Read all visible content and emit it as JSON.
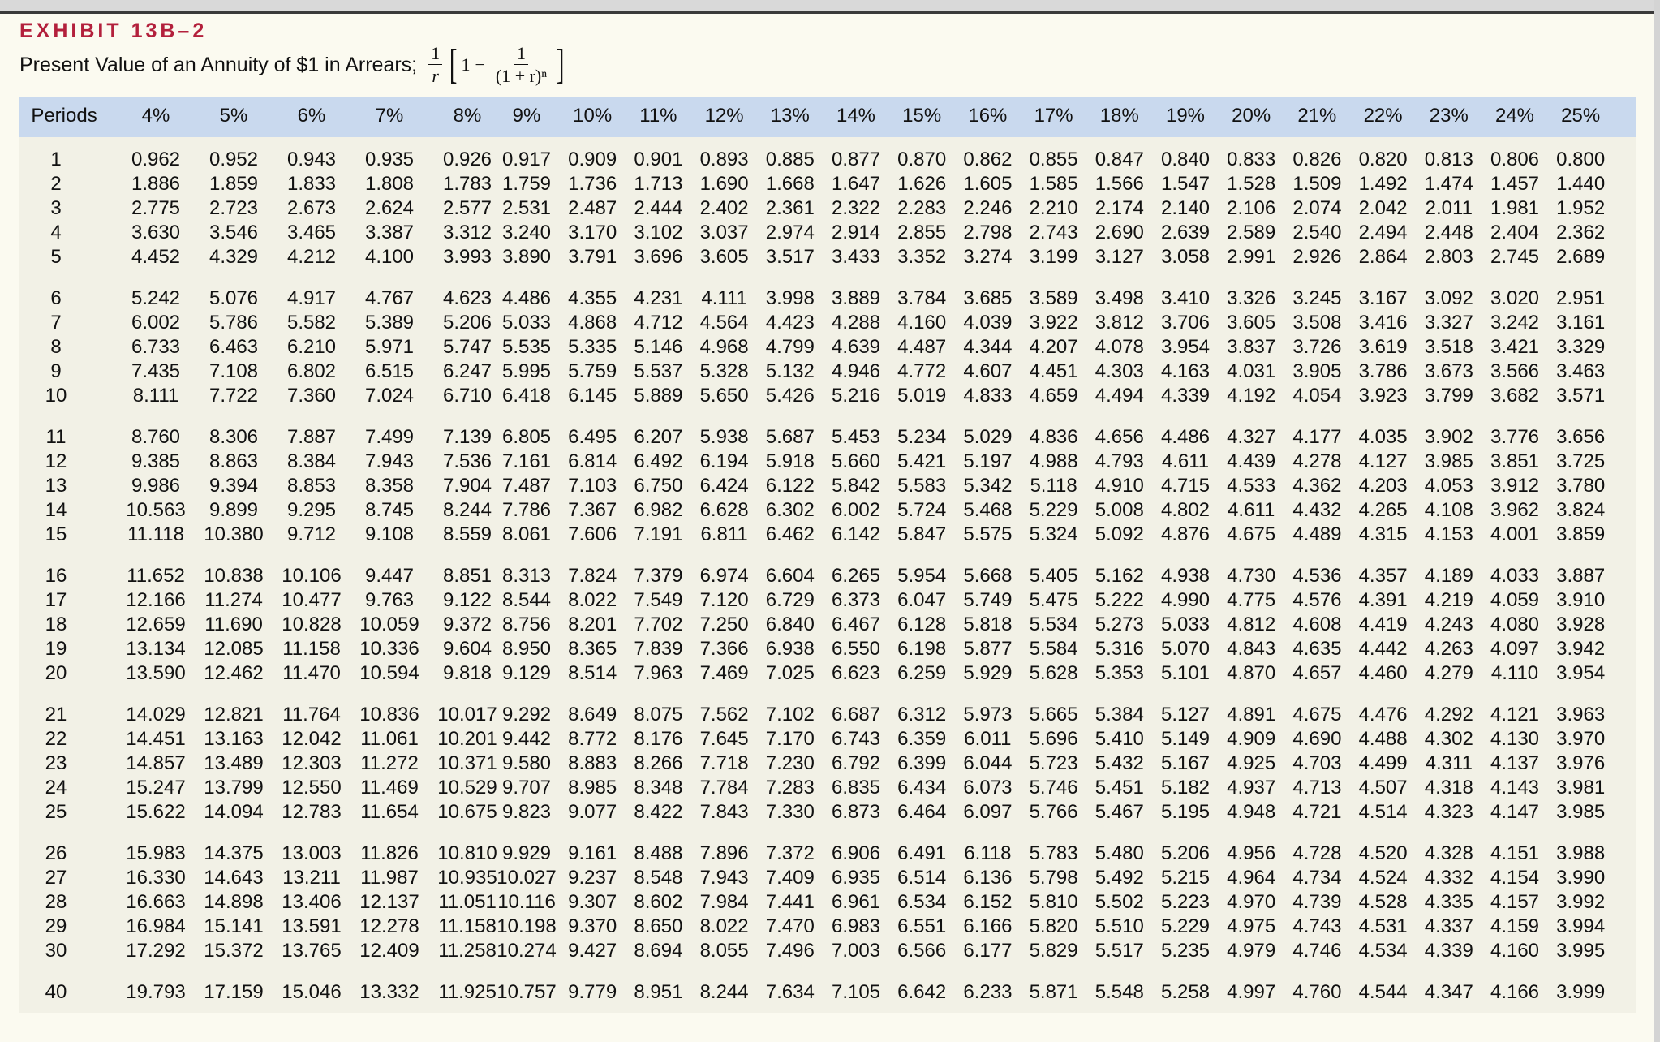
{
  "exhibit": {
    "label": "EXHIBIT 13B–2",
    "title": "Present Value of an Annuity of $1 in Arrears;",
    "formula": {
      "a_num": "1",
      "a_den": "r",
      "one": "1",
      "minus": "−",
      "b_num": "1",
      "b_den": "(1 + r)ⁿ"
    }
  },
  "table": {
    "period_header": "Periods",
    "rates": [
      "4%",
      "5%",
      "6%",
      "7%",
      "8%",
      "9%",
      "10%",
      "11%",
      "12%",
      "13%",
      "14%",
      "15%",
      "16%",
      "17%",
      "18%",
      "19%",
      "20%",
      "21%",
      "22%",
      "23%",
      "24%",
      "25%"
    ],
    "groups": [
      [
        {
          "period": "1",
          "values": [
            "0.962",
            "0.952",
            "0.943",
            "0.935",
            "0.926",
            "0.917",
            "0.909",
            "0.901",
            "0.893",
            "0.885",
            "0.877",
            "0.870",
            "0.862",
            "0.855",
            "0.847",
            "0.840",
            "0.833",
            "0.826",
            "0.820",
            "0.813",
            "0.806",
            "0.800"
          ]
        },
        {
          "period": "2",
          "values": [
            "1.886",
            "1.859",
            "1.833",
            "1.808",
            "1.783",
            "1.759",
            "1.736",
            "1.713",
            "1.690",
            "1.668",
            "1.647",
            "1.626",
            "1.605",
            "1.585",
            "1.566",
            "1.547",
            "1.528",
            "1.509",
            "1.492",
            "1.474",
            "1.457",
            "1.440"
          ]
        },
        {
          "period": "3",
          "values": [
            "2.775",
            "2.723",
            "2.673",
            "2.624",
            "2.577",
            "2.531",
            "2.487",
            "2.444",
            "2.402",
            "2.361",
            "2.322",
            "2.283",
            "2.246",
            "2.210",
            "2.174",
            "2.140",
            "2.106",
            "2.074",
            "2.042",
            "2.011",
            "1.981",
            "1.952"
          ]
        },
        {
          "period": "4",
          "values": [
            "3.630",
            "3.546",
            "3.465",
            "3.387",
            "3.312",
            "3.240",
            "3.170",
            "3.102",
            "3.037",
            "2.974",
            "2.914",
            "2.855",
            "2.798",
            "2.743",
            "2.690",
            "2.639",
            "2.589",
            "2.540",
            "2.494",
            "2.448",
            "2.404",
            "2.362"
          ]
        },
        {
          "period": "5",
          "values": [
            "4.452",
            "4.329",
            "4.212",
            "4.100",
            "3.993",
            "3.890",
            "3.791",
            "3.696",
            "3.605",
            "3.517",
            "3.433",
            "3.352",
            "3.274",
            "3.199",
            "3.127",
            "3.058",
            "2.991",
            "2.926",
            "2.864",
            "2.803",
            "2.745",
            "2.689"
          ]
        }
      ],
      [
        {
          "period": "6",
          "values": [
            "5.242",
            "5.076",
            "4.917",
            "4.767",
            "4.623",
            "4.486",
            "4.355",
            "4.231",
            "4.111",
            "3.998",
            "3.889",
            "3.784",
            "3.685",
            "3.589",
            "3.498",
            "3.410",
            "3.326",
            "3.245",
            "3.167",
            "3.092",
            "3.020",
            "2.951"
          ]
        },
        {
          "period": "7",
          "values": [
            "6.002",
            "5.786",
            "5.582",
            "5.389",
            "5.206",
            "5.033",
            "4.868",
            "4.712",
            "4.564",
            "4.423",
            "4.288",
            "4.160",
            "4.039",
            "3.922",
            "3.812",
            "3.706",
            "3.605",
            "3.508",
            "3.416",
            "3.327",
            "3.242",
            "3.161"
          ]
        },
        {
          "period": "8",
          "values": [
            "6.733",
            "6.463",
            "6.210",
            "5.971",
            "5.747",
            "5.535",
            "5.335",
            "5.146",
            "4.968",
            "4.799",
            "4.639",
            "4.487",
            "4.344",
            "4.207",
            "4.078",
            "3.954",
            "3.837",
            "3.726",
            "3.619",
            "3.518",
            "3.421",
            "3.329"
          ]
        },
        {
          "period": "9",
          "values": [
            "7.435",
            "7.108",
            "6.802",
            "6.515",
            "6.247",
            "5.995",
            "5.759",
            "5.537",
            "5.328",
            "5.132",
            "4.946",
            "4.772",
            "4.607",
            "4.451",
            "4.303",
            "4.163",
            "4.031",
            "3.905",
            "3.786",
            "3.673",
            "3.566",
            "3.463"
          ]
        },
        {
          "period": "10",
          "values": [
            "8.111",
            "7.722",
            "7.360",
            "7.024",
            "6.710",
            "6.418",
            "6.145",
            "5.889",
            "5.650",
            "5.426",
            "5.216",
            "5.019",
            "4.833",
            "4.659",
            "4.494",
            "4.339",
            "4.192",
            "4.054",
            "3.923",
            "3.799",
            "3.682",
            "3.571"
          ]
        }
      ],
      [
        {
          "period": "11",
          "values": [
            "8.760",
            "8.306",
            "7.887",
            "7.499",
            "7.139",
            "6.805",
            "6.495",
            "6.207",
            "5.938",
            "5.687",
            "5.453",
            "5.234",
            "5.029",
            "4.836",
            "4.656",
            "4.486",
            "4.327",
            "4.177",
            "4.035",
            "3.902",
            "3.776",
            "3.656"
          ]
        },
        {
          "period": "12",
          "values": [
            "9.385",
            "8.863",
            "8.384",
            "7.943",
            "7.536",
            "7.161",
            "6.814",
            "6.492",
            "6.194",
            "5.918",
            "5.660",
            "5.421",
            "5.197",
            "4.988",
            "4.793",
            "4.611",
            "4.439",
            "4.278",
            "4.127",
            "3.985",
            "3.851",
            "3.725"
          ]
        },
        {
          "period": "13",
          "values": [
            "9.986",
            "9.394",
            "8.853",
            "8.358",
            "7.904",
            "7.487",
            "7.103",
            "6.750",
            "6.424",
            "6.122",
            "5.842",
            "5.583",
            "5.342",
            "5.118",
            "4.910",
            "4.715",
            "4.533",
            "4.362",
            "4.203",
            "4.053",
            "3.912",
            "3.780"
          ]
        },
        {
          "period": "14",
          "values": [
            "10.563",
            "9.899",
            "9.295",
            "8.745",
            "8.244",
            "7.786",
            "7.367",
            "6.982",
            "6.628",
            "6.302",
            "6.002",
            "5.724",
            "5.468",
            "5.229",
            "5.008",
            "4.802",
            "4.611",
            "4.432",
            "4.265",
            "4.108",
            "3.962",
            "3.824"
          ]
        },
        {
          "period": "15",
          "values": [
            "11.118",
            "10.380",
            "9.712",
            "9.108",
            "8.559",
            "8.061",
            "7.606",
            "7.191",
            "6.811",
            "6.462",
            "6.142",
            "5.847",
            "5.575",
            "5.324",
            "5.092",
            "4.876",
            "4.675",
            "4.489",
            "4.315",
            "4.153",
            "4.001",
            "3.859"
          ]
        }
      ],
      [
        {
          "period": "16",
          "values": [
            "11.652",
            "10.838",
            "10.106",
            "9.447",
            "8.851",
            "8.313",
            "7.824",
            "7.379",
            "6.974",
            "6.604",
            "6.265",
            "5.954",
            "5.668",
            "5.405",
            "5.162",
            "4.938",
            "4.730",
            "4.536",
            "4.357",
            "4.189",
            "4.033",
            "3.887"
          ]
        },
        {
          "period": "17",
          "values": [
            "12.166",
            "11.274",
            "10.477",
            "9.763",
            "9.122",
            "8.544",
            "8.022",
            "7.549",
            "7.120",
            "6.729",
            "6.373",
            "6.047",
            "5.749",
            "5.475",
            "5.222",
            "4.990",
            "4.775",
            "4.576",
            "4.391",
            "4.219",
            "4.059",
            "3.910"
          ]
        },
        {
          "period": "18",
          "values": [
            "12.659",
            "11.690",
            "10.828",
            "10.059",
            "9.372",
            "8.756",
            "8.201",
            "7.702",
            "7.250",
            "6.840",
            "6.467",
            "6.128",
            "5.818",
            "5.534",
            "5.273",
            "5.033",
            "4.812",
            "4.608",
            "4.419",
            "4.243",
            "4.080",
            "3.928"
          ]
        },
        {
          "period": "19",
          "values": [
            "13.134",
            "12.085",
            "11.158",
            "10.336",
            "9.604",
            "8.950",
            "8.365",
            "7.839",
            "7.366",
            "6.938",
            "6.550",
            "6.198",
            "5.877",
            "5.584",
            "5.316",
            "5.070",
            "4.843",
            "4.635",
            "4.442",
            "4.263",
            "4.097",
            "3.942"
          ]
        },
        {
          "period": "20",
          "values": [
            "13.590",
            "12.462",
            "11.470",
            "10.594",
            "9.818",
            "9.129",
            "8.514",
            "7.963",
            "7.469",
            "7.025",
            "6.623",
            "6.259",
            "5.929",
            "5.628",
            "5.353",
            "5.101",
            "4.870",
            "4.657",
            "4.460",
            "4.279",
            "4.110",
            "3.954"
          ]
        }
      ],
      [
        {
          "period": "21",
          "values": [
            "14.029",
            "12.821",
            "11.764",
            "10.836",
            "10.017",
            "9.292",
            "8.649",
            "8.075",
            "7.562",
            "7.102",
            "6.687",
            "6.312",
            "5.973",
            "5.665",
            "5.384",
            "5.127",
            "4.891",
            "4.675",
            "4.476",
            "4.292",
            "4.121",
            "3.963"
          ]
        },
        {
          "period": "22",
          "values": [
            "14.451",
            "13.163",
            "12.042",
            "11.061",
            "10.201",
            "9.442",
            "8.772",
            "8.176",
            "7.645",
            "7.170",
            "6.743",
            "6.359",
            "6.011",
            "5.696",
            "5.410",
            "5.149",
            "4.909",
            "4.690",
            "4.488",
            "4.302",
            "4.130",
            "3.970"
          ]
        },
        {
          "period": "23",
          "values": [
            "14.857",
            "13.489",
            "12.303",
            "11.272",
            "10.371",
            "9.580",
            "8.883",
            "8.266",
            "7.718",
            "7.230",
            "6.792",
            "6.399",
            "6.044",
            "5.723",
            "5.432",
            "5.167",
            "4.925",
            "4.703",
            "4.499",
            "4.311",
            "4.137",
            "3.976"
          ]
        },
        {
          "period": "24",
          "values": [
            "15.247",
            "13.799",
            "12.550",
            "11.469",
            "10.529",
            "9.707",
            "8.985",
            "8.348",
            "7.784",
            "7.283",
            "6.835",
            "6.434",
            "6.073",
            "5.746",
            "5.451",
            "5.182",
            "4.937",
            "4.713",
            "4.507",
            "4.318",
            "4.143",
            "3.981"
          ]
        },
        {
          "period": "25",
          "values": [
            "15.622",
            "14.094",
            "12.783",
            "11.654",
            "10.675",
            "9.823",
            "9.077",
            "8.422",
            "7.843",
            "7.330",
            "6.873",
            "6.464",
            "6.097",
            "5.766",
            "5.467",
            "5.195",
            "4.948",
            "4.721",
            "4.514",
            "4.323",
            "4.147",
            "3.985"
          ]
        }
      ],
      [
        {
          "period": "26",
          "values": [
            "15.983",
            "14.375",
            "13.003",
            "11.826",
            "10.810",
            "9.929",
            "9.161",
            "8.488",
            "7.896",
            "7.372",
            "6.906",
            "6.491",
            "6.118",
            "5.783",
            "5.480",
            "5.206",
            "4.956",
            "4.728",
            "4.520",
            "4.328",
            "4.151",
            "3.988"
          ]
        },
        {
          "period": "27",
          "values": [
            "16.330",
            "14.643",
            "13.211",
            "11.987",
            "10.935",
            "10.027",
            "9.237",
            "8.548",
            "7.943",
            "7.409",
            "6.935",
            "6.514",
            "6.136",
            "5.798",
            "5.492",
            "5.215",
            "4.964",
            "4.734",
            "4.524",
            "4.332",
            "4.154",
            "3.990"
          ]
        },
        {
          "period": "28",
          "values": [
            "16.663",
            "14.898",
            "13.406",
            "12.137",
            "11.051",
            "10.116",
            "9.307",
            "8.602",
            "7.984",
            "7.441",
            "6.961",
            "6.534",
            "6.152",
            "5.810",
            "5.502",
            "5.223",
            "4.970",
            "4.739",
            "4.528",
            "4.335",
            "4.157",
            "3.992"
          ]
        },
        {
          "period": "29",
          "values": [
            "16.984",
            "15.141",
            "13.591",
            "12.278",
            "11.158",
            "10.198",
            "9.370",
            "8.650",
            "8.022",
            "7.470",
            "6.983",
            "6.551",
            "6.166",
            "5.820",
            "5.510",
            "5.229",
            "4.975",
            "4.743",
            "4.531",
            "4.337",
            "4.159",
            "3.994"
          ]
        },
        {
          "period": "30",
          "values": [
            "17.292",
            "15.372",
            "13.765",
            "12.409",
            "11.258",
            "10.274",
            "9.427",
            "8.694",
            "8.055",
            "7.496",
            "7.003",
            "6.566",
            "6.177",
            "5.829",
            "5.517",
            "5.235",
            "4.979",
            "4.746",
            "4.534",
            "4.339",
            "4.160",
            "3.995"
          ]
        }
      ],
      [
        {
          "period": "40",
          "values": [
            "19.793",
            "17.159",
            "15.046",
            "13.332",
            "11.925",
            "10.757",
            "9.779",
            "8.951",
            "8.244",
            "7.634",
            "7.105",
            "6.642",
            "6.233",
            "5.871",
            "5.548",
            "5.258",
            "4.997",
            "4.760",
            "4.544",
            "4.347",
            "4.166",
            "3.999"
          ]
        }
      ]
    ]
  }
}
